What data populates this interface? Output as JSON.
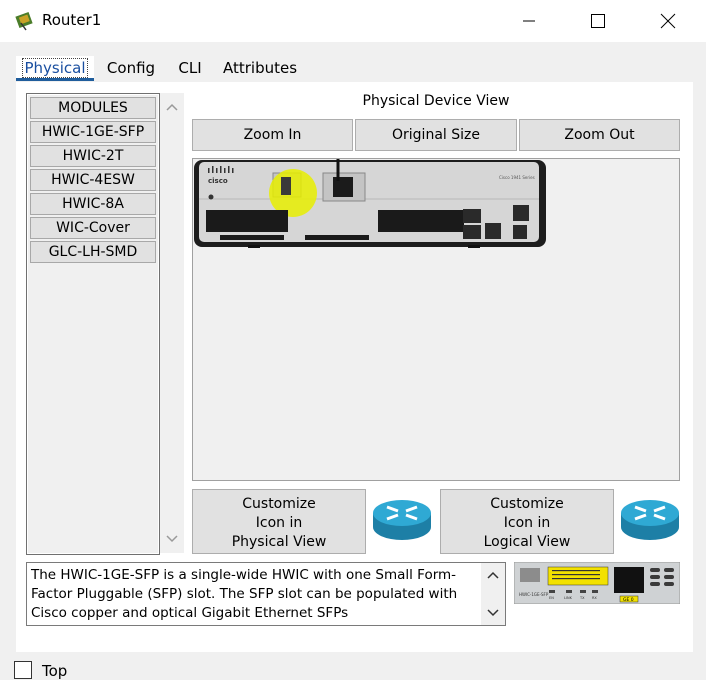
{
  "window": {
    "title": "Router1",
    "icon": "router-app-icon",
    "controls": [
      "minimize-icon",
      "maximize-icon",
      "close-icon"
    ]
  },
  "tabs": [
    {
      "label": "Physical",
      "active": true
    },
    {
      "label": "Config",
      "active": false
    },
    {
      "label": "CLI",
      "active": false
    },
    {
      "label": "Attributes",
      "active": false
    }
  ],
  "modules": {
    "header": "MODULES",
    "items": [
      "HWIC-1GE-SFP",
      "HWIC-2T",
      "HWIC-4ESW",
      "HWIC-8A",
      "WIC-Cover",
      "GLC-LH-SMD"
    ]
  },
  "physical_view": {
    "title": "Physical Device View",
    "zoom_in": "Zoom In",
    "original_size": "Original Size",
    "zoom_out": "Zoom Out",
    "device_brand": "cisco",
    "device_model": "Cisco 1941 Series"
  },
  "customize": {
    "physical_lines": [
      "Customize",
      "Icon in",
      "Physical View"
    ],
    "logical_lines": [
      "Customize",
      "Icon in",
      "Logical View"
    ]
  },
  "description": "The HWIC-1GE-SFP is a single-wide HWIC with one Small Form-Factor Pluggable (SFP) slot. The SFP slot can be populated with Cisco copper and optical Gigabit Ethernet SFPs",
  "module_preview": {
    "label": "HWIC-1GE-SFP",
    "badge": "GE 0",
    "leds": [
      "EN",
      "LINK",
      "TX",
      "RX"
    ]
  },
  "footer": {
    "checkbox_label": "Top",
    "checked": false
  },
  "colors": {
    "highlight": "#e8ee00",
    "router_blue": "#1d8fb8",
    "tab_underline": "#1f5d9c"
  }
}
